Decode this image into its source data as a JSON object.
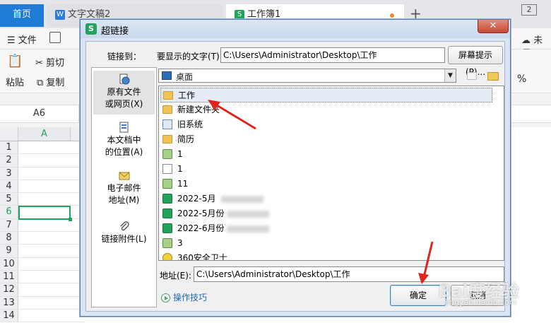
{
  "app": {
    "tabs": [
      {
        "label": "首页"
      },
      {
        "label": "文字文稿2"
      },
      {
        "label": "工作簿1"
      }
    ],
    "new_tab": "+",
    "window_btn": "2",
    "menu": {
      "file": "文件",
      "cloud": "未保"
    },
    "ribbon": {
      "paste": "粘贴",
      "cut": "剪切",
      "copy": "复制",
      "percent": "%"
    },
    "cell_ref": "A6",
    "sheet": {
      "column": "A",
      "rows": [
        "1",
        "2",
        "3",
        "4",
        "5",
        "6",
        "7",
        "8",
        "9",
        "10",
        "11",
        "12",
        "13",
        "14"
      ],
      "active_row": "6"
    }
  },
  "dialog": {
    "title": "超链接",
    "close": "✕",
    "link_to_label": "链接到：",
    "display_text_label": "要显示的文字(T):",
    "display_text_value": "C:\\Users\\Administrator\\Desktop\\工作",
    "screen_tip_button": "屏幕提示(P)...",
    "sidebar": [
      {
        "label": "原有文件\n或网页(X)",
        "selected": true
      },
      {
        "label": "本文档中\n的位置(A)",
        "selected": false
      },
      {
        "label": "电子邮件\n地址(M)",
        "selected": false
      },
      {
        "label": "链接附件(L)",
        "selected": false
      }
    ],
    "look_in": "桌面",
    "files": [
      {
        "name": "工作",
        "icon": "folder-icon",
        "selected": true
      },
      {
        "name": "新建文件夹",
        "icon": "folder-icon",
        "selected": false
      },
      {
        "name": "旧系统",
        "icon": "shortcut-icon",
        "selected": false
      },
      {
        "name": "简历",
        "icon": "folder-icon",
        "selected": false
      },
      {
        "name": "1",
        "icon": "png-icon",
        "selected": false
      },
      {
        "name": "1",
        "icon": "doc-icon",
        "selected": false
      },
      {
        "name": "11",
        "icon": "png-icon",
        "selected": false
      },
      {
        "name": "2022-5月",
        "icon": "xls-icon",
        "selected": false
      },
      {
        "name": "2022-5月份",
        "icon": "xls-icon",
        "selected": false
      },
      {
        "name": "2022-6月份",
        "icon": "xls-icon",
        "selected": false
      },
      {
        "name": "3",
        "icon": "png-icon",
        "selected": false
      },
      {
        "name": "360安全卫士",
        "icon": "360-icon",
        "selected": false
      }
    ],
    "address_label": "地址(E):",
    "address_value": "C:\\Users\\Administrator\\Desktop\\工作",
    "tips_link": "操作技巧",
    "ok_button": "确定",
    "cancel_button": "取消"
  },
  "watermark": {
    "main": "Bai度经验",
    "sub": "jingyan.baidu.com"
  },
  "colors": {
    "accent_green": "#21a35c",
    "tab_blue": "#1f7bd6",
    "arrow_red": "#e0241b"
  }
}
